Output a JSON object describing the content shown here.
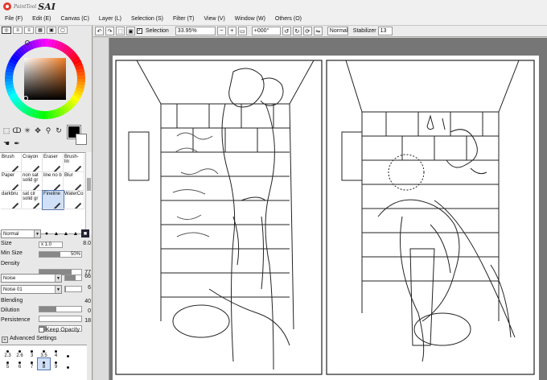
{
  "app": {
    "logo_small": "PaintTool",
    "logo_big": "SAI"
  },
  "menu": [
    {
      "label": "File (F)"
    },
    {
      "label": "Edit (E)"
    },
    {
      "label": "Canvas (C)"
    },
    {
      "label": "Layer (L)"
    },
    {
      "label": "Selection (S)"
    },
    {
      "label": "Filter (T)"
    },
    {
      "label": "View (V)"
    },
    {
      "label": "Window (W)"
    },
    {
      "label": "Others (O)"
    }
  ],
  "toolbar": {
    "selection_label": "Selection",
    "zoom": "33.95%",
    "rotation": "+000°",
    "mode": "Normal",
    "stabilizer_label": "Stabilizer",
    "stabilizer_value": "13"
  },
  "brushes": [
    {
      "label": "Brush"
    },
    {
      "label": "Crayon"
    },
    {
      "label": "Eraser"
    },
    {
      "label": "Brush-lin"
    },
    {
      "label": "Paper"
    },
    {
      "label": "non sat solid gr"
    },
    {
      "label": "line no b"
    },
    {
      "label": "Blur"
    },
    {
      "label": "darkbru"
    },
    {
      "label": "sat cir solid gr"
    },
    {
      "label": "Fineline"
    },
    {
      "label": "WaterCo"
    }
  ],
  "selected_brush": "Fineline",
  "tool_options": {
    "blend_mode": "Normal",
    "size_label": "Size",
    "size_mult": "x 1.0",
    "size_value": "8.0",
    "min_size_label": "Min Size",
    "min_size_value": "50%",
    "min_size_fraction": 0.5,
    "density_label": "Density",
    "density_value": "77",
    "density_fraction": 0.77,
    "texture1": "Noise",
    "texture1_value": "66",
    "texture2": "Noise 01",
    "texture2_value": "6",
    "blending_label": "Blending",
    "blending_value": "40",
    "blending_fraction": 0.4,
    "dilution_label": "Dilution",
    "dilution_value": "0",
    "dilution_fraction": 0.0,
    "persistence_label": "Persistence",
    "persistence_value": "18",
    "persistence_fraction": 0.18,
    "keep_opacity_label": "Keep Opacity",
    "advanced_label": "Advanced Settings"
  },
  "brush_sizes": [
    {
      "label": "2.3"
    },
    {
      "label": "2.6"
    },
    {
      "label": "3"
    },
    {
      "label": "3.5"
    },
    {
      "label": "4"
    },
    {
      "label": ""
    },
    {
      "label": "5"
    },
    {
      "label": "6"
    },
    {
      "label": "7"
    },
    {
      "label": "8"
    },
    {
      "label": "9"
    },
    {
      "label": ""
    }
  ],
  "selected_size": "8",
  "colors": {
    "wheel_hue": "#f07a20",
    "foreground": "#000000",
    "background": "#ffffff"
  }
}
